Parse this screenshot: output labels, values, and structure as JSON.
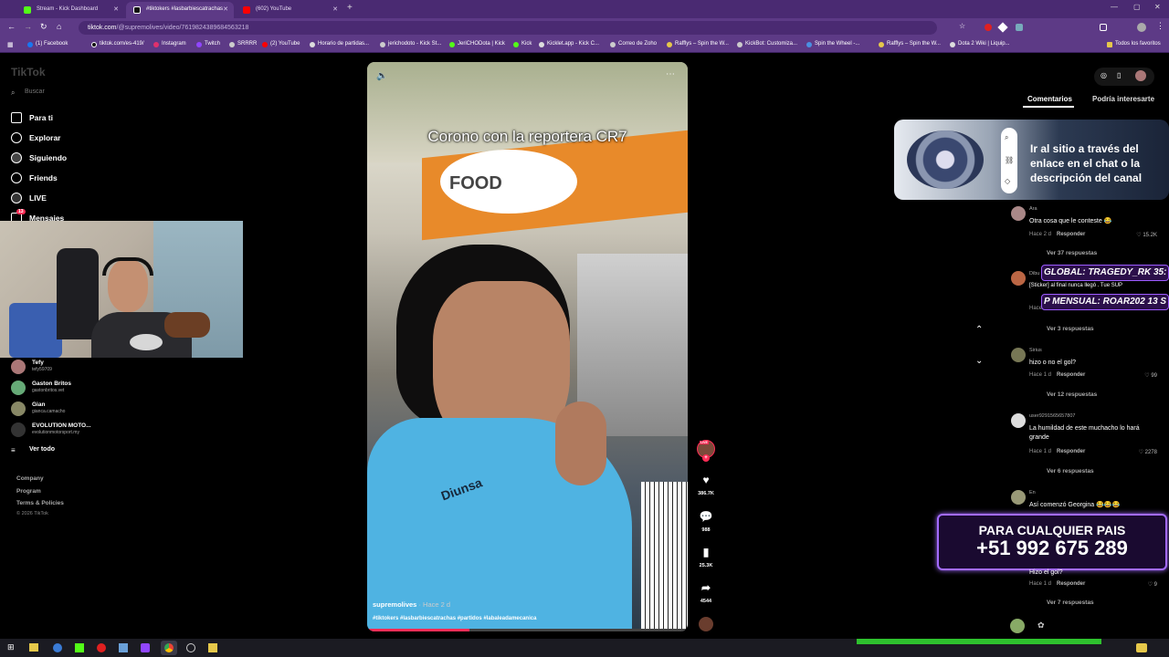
{
  "tabs": [
    {
      "title": "Stream - Kick Dashboard",
      "color": "#53fc18"
    },
    {
      "title": "#tiktokers #lasbarbiescatrachas",
      "color": "#111"
    },
    {
      "title": "(602) YouTube",
      "color": "#ff0000"
    }
  ],
  "address": {
    "host": "tiktok.com",
    "path": "/@supremolives/video/7619824389684563218"
  },
  "bookmarks": [
    "(1) Facebook",
    "tiktok.com/es-419/",
    "Instagram",
    "Twitch",
    "SRRRR",
    "(2) YouTube",
    "Horario de partidas...",
    "jerichodoto - Kick St...",
    "JeriCHODota | Kick",
    "Kick",
    "Kicklet.app - Kick C...",
    "Correo de Zoho",
    "Rafflys – Spin the W...",
    "KickBot: Customiza...",
    "Spin the Wheel -...",
    "Rafflys – Spin the W...",
    "Dota 2 Wiki | Liquip..."
  ],
  "bookmarks_all": "Todos los favoritos",
  "sidebar": {
    "logo": "TikTok",
    "search_placeholder": "Buscar",
    "nav": [
      "Para ti",
      "Explorar",
      "Siguiendo",
      "Friends",
      "LIVE",
      "Mensajes"
    ],
    "messages_badge": "13",
    "following": [
      {
        "name": "Tefy",
        "handle": "tefy59709"
      },
      {
        "name": "Gaston Britos",
        "handle": "gastonbritos.vet"
      },
      {
        "name": "Gian",
        "handle": "gianca.camacho"
      },
      {
        "name": "EVOLUTION MOTO...",
        "handle": "evolutionmotorsport.my"
      }
    ],
    "see_all": "Ver todo",
    "footer": [
      "Company",
      "Program",
      "Terms & Policies",
      "© 2026 TikTok"
    ]
  },
  "video": {
    "caption": "Corono con la reportera CR7",
    "sign": "FOOD",
    "author": "supremolives",
    "posted": "· Hace 2 d",
    "hashtags": "#tiktokers #lasbarbiescatrachas #partidos #labaleadamecanica",
    "jersey": "Diunsa"
  },
  "actions": {
    "likes": "386.7K",
    "comments": "988",
    "saves": "25.3K",
    "shares": "4544",
    "live_badge": "LIVE"
  },
  "panel_tabs": [
    "Comentarios",
    "Podría interesarte"
  ],
  "overlays": {
    "banner": "Ir al sitio a través del enlace en el chat o la descripción del canal",
    "ticker1": "GLOBAL: TRAGEDY_RK 35:",
    "ticker2": "P MENSUAL: ROAR202 13 S",
    "promo_line1": "PARA CUALQUIER PAIS",
    "promo_line2": "+51 992 675 289"
  },
  "comments": [
    {
      "user": "Ara",
      "text": "Otra cosa que le conteste 😂",
      "meta": "Hace 2 d",
      "reply": "Responder",
      "likes": "15.2K",
      "more": "Ver 37 respuestas"
    },
    {
      "user": "Dibu",
      "text": "[Sticker] al final nunca llegó . Tue SUP",
      "meta": "Hace",
      "reply": "",
      "likes": "",
      "more": "Ver 3 respuestas"
    },
    {
      "user": "Sirius",
      "text": "hizo o no el gol?",
      "meta": "Hace 1 d",
      "reply": "Responder",
      "likes": "99",
      "more": "Ver 12 respuestas"
    },
    {
      "user": "user9291565657807",
      "text": "La humildad de este muchacho lo hará grande",
      "meta": "Hace 1 d",
      "reply": "Responder",
      "likes": "2278",
      "more": "Ver 6 respuestas"
    },
    {
      "user": "En",
      "text": "Así comenzó Georgina 😂😂😂",
      "meta": "",
      "reply": "",
      "likes": "",
      "more": ""
    },
    {
      "user": "",
      "text": "Hizo el gol?",
      "meta": "Hace 1 d",
      "reply": "Responder",
      "likes": "9",
      "more": "Ver 7 respuestas"
    }
  ]
}
